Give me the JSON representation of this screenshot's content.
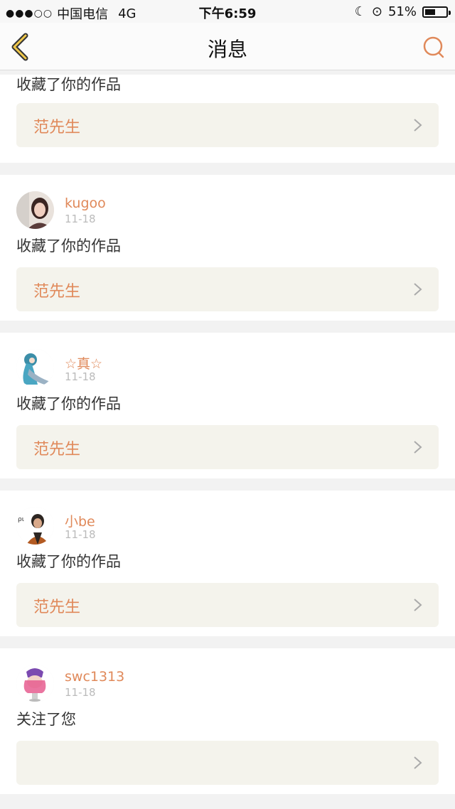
{
  "status_bar": {
    "carrier": "中国电信",
    "network": "4G",
    "time": "下午6:59",
    "battery": "51%",
    "battery_level": 0.51
  },
  "header": {
    "title": "消息",
    "accent_color": "#e0895a"
  },
  "notifications": [
    {
      "username": "",
      "date": "",
      "action": "收藏了你的作品",
      "work_title": "范先生"
    },
    {
      "username": "kugoo",
      "date": "11-18",
      "action": "收藏了你的作品",
      "work_title": "范先生",
      "avatar_icon": "avatar-girl-photo"
    },
    {
      "username": "☆真☆",
      "date": "11-18",
      "action": "收藏了你的作品",
      "work_title": "范先生",
      "avatar_icon": "avatar-anime-character"
    },
    {
      "username": "小be",
      "date": "11-18",
      "action": "收藏了你的作品",
      "work_title": "范先生",
      "avatar_icon": "avatar-person-photo"
    },
    {
      "username": "swc1313",
      "date": "11-18",
      "action": "关注了您",
      "work_title": "",
      "avatar_icon": "avatar-cartoon-figure"
    }
  ]
}
